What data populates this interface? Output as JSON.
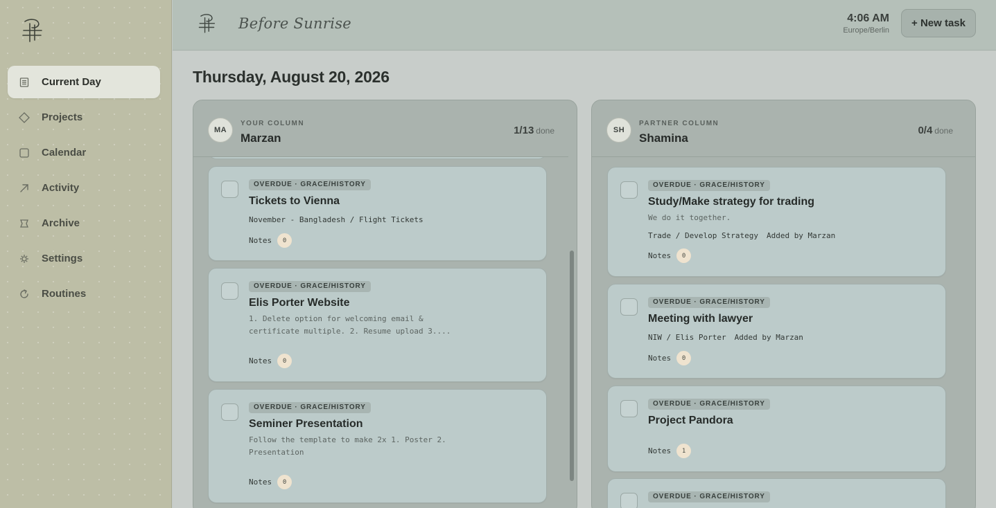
{
  "sidebar": {
    "items": [
      {
        "label": "Current Day",
        "icon": "list-icon",
        "active": true
      },
      {
        "label": "Projects",
        "icon": "diamond-icon",
        "active": false
      },
      {
        "label": "Calendar",
        "icon": "square-icon",
        "active": false
      },
      {
        "label": "Activity",
        "icon": "arrow-up-right-icon",
        "active": false
      },
      {
        "label": "Archive",
        "icon": "bookmark-icon",
        "active": false
      },
      {
        "label": "Settings",
        "icon": "gear-icon",
        "active": false
      },
      {
        "label": "Routines",
        "icon": "refresh-icon",
        "active": false
      }
    ]
  },
  "header": {
    "brand": "Before Sunrise",
    "time": "4:06 AM",
    "timezone": "Europe/Berlin",
    "new_task_label": "+ New task"
  },
  "main": {
    "date": "Thursday, August 20, 2026",
    "columns": [
      {
        "avatar": "MA",
        "kicker": "YOUR COLUMN",
        "name": "Marzan",
        "count": "1/13",
        "done_label": "done",
        "cards": [
          {
            "tag": "OVERDUE · GRACE/HISTORY",
            "title": "Tickets to Vienna",
            "meta": [
              "November - Bangladesh / Flight Tickets"
            ],
            "notes_label": "Notes",
            "notes_count": "0"
          },
          {
            "tag": "OVERDUE · GRACE/HISTORY",
            "title": "Elis Porter Website",
            "desc": "1. Delete option for welcoming email & certificate multiple. 2. Resume upload 3....",
            "notes_label": "Notes",
            "notes_count": "0"
          },
          {
            "tag": "OVERDUE · GRACE/HISTORY",
            "title": "Seminer Presentation",
            "desc": "Follow the template to make 2x 1. Poster 2. Presentation",
            "notes_label": "Notes",
            "notes_count": "0"
          }
        ]
      },
      {
        "avatar": "SH",
        "kicker": "PARTNER COLUMN",
        "name": "Shamina",
        "count": "0/4",
        "done_label": "done",
        "cards": [
          {
            "tag": "OVERDUE · GRACE/HISTORY",
            "title": "Study/Make strategy for trading",
            "desc": "We do it together.",
            "meta": [
              "Trade / Develop Strategy",
              "Added by Marzan"
            ],
            "notes_label": "Notes",
            "notes_count": "0"
          },
          {
            "tag": "OVERDUE · GRACE/HISTORY",
            "title": "Meeting with lawyer",
            "meta": [
              "NIW / Elis Porter",
              "Added by Marzan"
            ],
            "notes_label": "Notes",
            "notes_count": "0"
          },
          {
            "tag": "OVERDUE · GRACE/HISTORY",
            "title": "Project Pandora",
            "notes_label": "Notes",
            "notes_count": "1"
          },
          {
            "tag": "OVERDUE · GRACE/HISTORY"
          }
        ]
      }
    ]
  }
}
